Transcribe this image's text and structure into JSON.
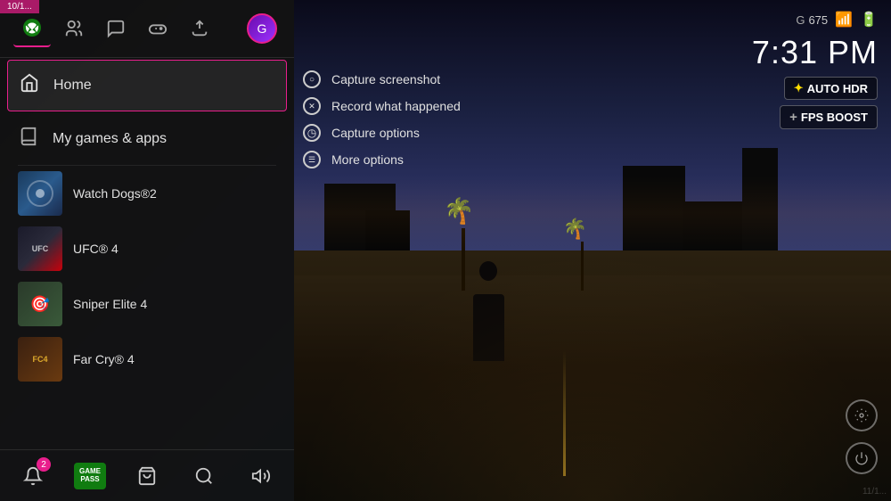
{
  "watermark": {
    "text": "10/1..."
  },
  "nav": {
    "icons": [
      {
        "name": "xbox-icon",
        "label": "Xbox",
        "active": true,
        "symbol": "⊞"
      },
      {
        "name": "people-icon",
        "label": "People",
        "active": false,
        "symbol": "👤"
      },
      {
        "name": "chat-icon",
        "label": "Chat",
        "active": false,
        "symbol": "💬"
      },
      {
        "name": "controller-icon",
        "label": "Controller",
        "active": false,
        "symbol": "🎮"
      },
      {
        "name": "share-icon",
        "label": "Share",
        "active": false,
        "symbol": "↑"
      },
      {
        "name": "profile-icon",
        "label": "Profile",
        "active": false,
        "symbol": "👤"
      }
    ]
  },
  "menu": {
    "items": [
      {
        "id": "home",
        "label": "Home",
        "icon": "⌂",
        "active": true
      },
      {
        "id": "my-games",
        "label": "My games & apps",
        "icon": "📚",
        "active": false
      }
    ]
  },
  "games": [
    {
      "id": "watchdogs2",
      "label": "Watch Dogs®2",
      "thumbClass": "thumb-watchdogs"
    },
    {
      "id": "ufc4",
      "label": "UFC® 4",
      "thumbClass": "thumb-ufc"
    },
    {
      "id": "sniper4",
      "label": "Sniper Elite 4",
      "thumbClass": "thumb-sniper"
    },
    {
      "id": "farcry4",
      "label": "Far Cry® 4",
      "thumbClass": "thumb-farcry"
    }
  ],
  "context_menu": {
    "items": [
      {
        "id": "capture-screenshot",
        "label": "Capture screenshot",
        "icon": "○"
      },
      {
        "id": "record-happened",
        "label": "Record what happened",
        "icon": "✕"
      },
      {
        "id": "capture-options",
        "label": "Capture options",
        "icon": "◷"
      },
      {
        "id": "more-options",
        "label": "More options",
        "icon": "☰"
      }
    ]
  },
  "hud": {
    "time": "7:31 PM",
    "battery_icon": "🔋",
    "signal_icon": "📶",
    "points": "675",
    "auto_hdr": "AUTO HDR",
    "fps_boost": "FPS BOOST"
  },
  "bottom_nav": {
    "items": [
      {
        "id": "notifications",
        "label": "Notifications",
        "icon": "🔔",
        "badge": "2"
      },
      {
        "id": "game-pass",
        "label": "Game Pass",
        "special": true,
        "line1": "GAME",
        "line2": "PASS"
      },
      {
        "id": "store",
        "label": "Store",
        "icon": "🛍"
      },
      {
        "id": "search",
        "label": "Search",
        "icon": "🔍"
      },
      {
        "id": "audio",
        "label": "Audio",
        "icon": "🔊"
      }
    ]
  }
}
